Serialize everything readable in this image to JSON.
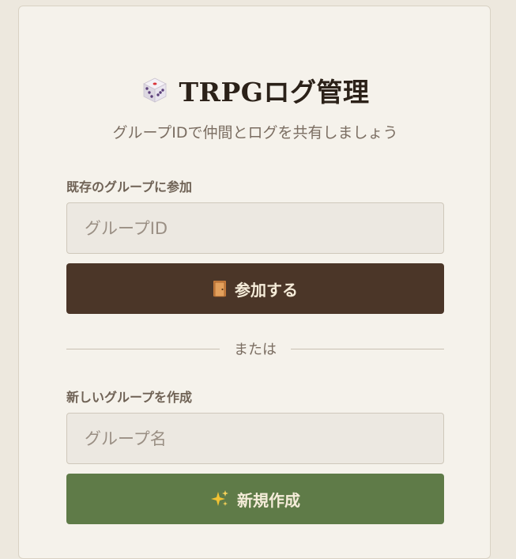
{
  "header": {
    "icon": "dice-icon",
    "title": "TRPGログ管理",
    "subtitle": "グループIDで仲間とログを共有しましょう"
  },
  "join_section": {
    "label": "既存のグループに参加",
    "input_placeholder": "グループID",
    "input_value": "",
    "button_icon": "door-icon",
    "button_label": "参加する",
    "button_color": "#4b3628"
  },
  "divider": {
    "text": "または"
  },
  "create_section": {
    "label": "新しいグループを作成",
    "input_placeholder": "グループ名",
    "input_value": "",
    "button_icon": "sparkle-icon",
    "button_label": "新規作成",
    "button_color": "#5f7b48"
  }
}
